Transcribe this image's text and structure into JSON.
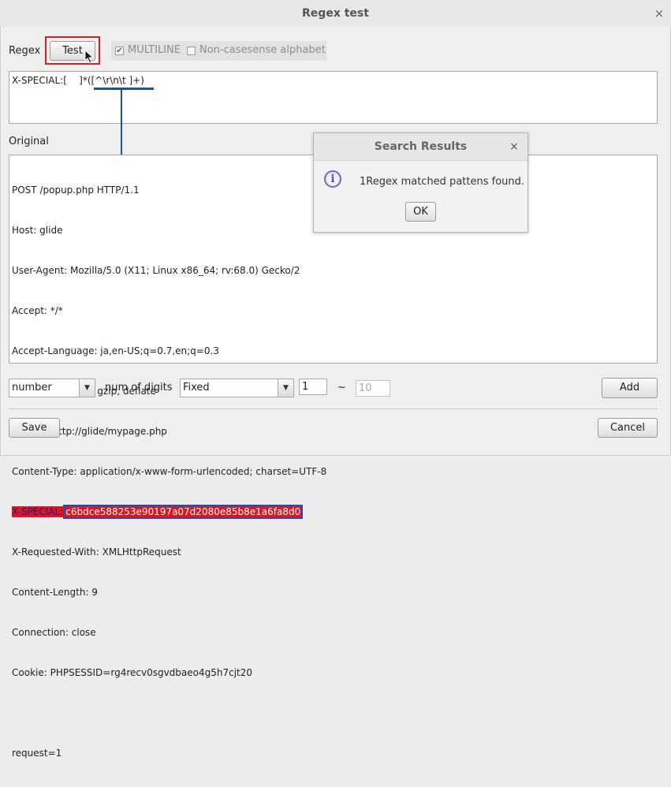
{
  "window": {
    "title": "Regex test",
    "close_glyph": "×"
  },
  "regex_row": {
    "label": "Regex",
    "test_button": "Test",
    "multiline_label": "MULTILINE",
    "noncase_label": "Non-casesense alphabet"
  },
  "regex_input": {
    "value": "X-SPECIAL:[    ]*([^\\r\\n\\t ]+)"
  },
  "original": {
    "label": "Original",
    "lines_before": [
      "POST /popup.php HTTP/1.1",
      "Host: glide",
      "User-Agent: Mozilla/5.0 (X11; Linux x86_64; rv:68.0) Gecko/2",
      "Accept: */*",
      "Accept-Language: ja,en-US;q=0.7,en;q=0.3",
      "Accept-Encoding: gzip, deflate",
      "Referer: http://glide/mypage.php",
      "Content-Type: application/x-www-form-urlencoded; charset=UTF-8"
    ],
    "match_prefix": "X-SPECIAL:",
    "match_group": "c6bdce588253e90197a07d2080e85b8e1a6fa8d0",
    "lines_after": [
      "X-Requested-With: XMLHttpRequest",
      "Content-Length: 9",
      "Connection: close",
      "Cookie: PHPSESSID=rg4recv0sgvdbaeo4g5h7cjt20",
      "",
      "request=1"
    ]
  },
  "bottom": {
    "type_select": "number",
    "digits_label": "num of digits",
    "digits_mode": "Fixed",
    "min_value": "1",
    "tilde": "~",
    "max_value": "10",
    "add_button": "Add",
    "save_button": "Save",
    "cancel_button": "Cancel"
  },
  "dialog": {
    "title": "Search Results",
    "close_glyph": "×",
    "icon": "info-icon",
    "message": "1Regex matched pattens found.",
    "ok_button": "OK"
  },
  "colors": {
    "highlight_red": "#e2151d",
    "annotation_blue": "#1a4dbf",
    "test_outline": "#d42020"
  }
}
